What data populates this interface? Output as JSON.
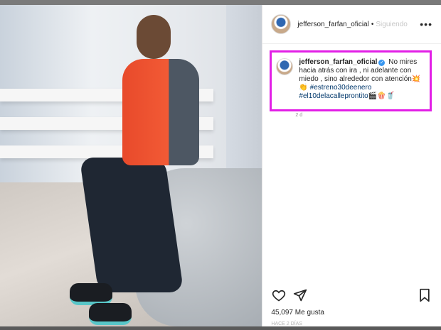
{
  "post": {
    "author": {
      "username": "jefferson_farfan_oficial",
      "separator": "•",
      "follow_status": "Siguiendo"
    },
    "more_icon": "more-horizontal-icon",
    "caption": {
      "username": "jefferson_farfan_oficial",
      "verified_icon": "verified-badge-icon",
      "text": "No mires hacia atrás con ira , ni adelante con miedo , sino alrededor con atención",
      "emoji_1": "💥👏",
      "hashtag_1": "#estreno30deenero",
      "hashtag_2": "#el10delacalleprontito",
      "emoji_2": "🎬🍿🥤",
      "time": "2 d"
    },
    "actions": {
      "like_icon": "heart-icon",
      "share_icon": "send-icon",
      "save_icon": "bookmark-icon"
    },
    "likes_text": "45,097 Me gusta",
    "date_text": "HACE 2 DÍAS"
  },
  "colors": {
    "highlight_border": "#e21fe6",
    "hashtag": "#00376b",
    "verified": "#3897f0"
  }
}
